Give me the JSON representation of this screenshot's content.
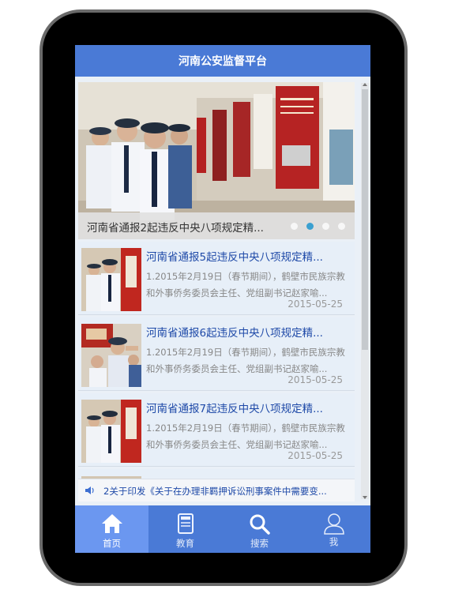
{
  "header": {
    "title": "河南公安监督平台"
  },
  "banner": {
    "caption": "河南省通报2起违反中央八项规定精...",
    "dots": 4,
    "active_dot": 1
  },
  "news": [
    {
      "title": "河南省通报5起违反中央八项规定精...",
      "desc": "1.2015年2月19日（春节期间），鹤壁市民族宗教和外事侨务委员会主任、党组副书记赵家喻...",
      "date": "2015-05-25"
    },
    {
      "title": "河南省通报6起违反中央八项规定精...",
      "desc": "1.2015年2月19日（春节期间），鹤壁市民族宗教和外事侨务委员会主任、党组副书记赵家喻...",
      "date": "2015-05-25"
    },
    {
      "title": "河南省通报7起违反中央八项规定精...",
      "desc": "1.2015年2月19日（春节期间），鹤壁市民族宗教和外事侨务委员会主任、党组副书记赵家喻...",
      "date": "2015-05-25"
    }
  ],
  "ticker": {
    "text": "2关于印发《关于在办理非羁押诉讼刑事案件中需要变..."
  },
  "tabs": [
    {
      "label": "首页",
      "icon": "home-icon"
    },
    {
      "label": "教育",
      "icon": "book-icon"
    },
    {
      "label": "搜索",
      "icon": "search-icon"
    },
    {
      "label": "我",
      "icon": "user-icon"
    }
  ],
  "colors": {
    "primary": "#4a7ad6",
    "active_tab": "#6b97f0",
    "title_link": "#1f4aa8",
    "dot_active": "#3aa0d0"
  }
}
